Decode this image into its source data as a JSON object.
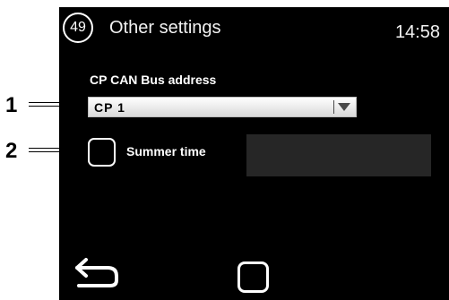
{
  "header": {
    "page_number": "49",
    "title": "Other settings",
    "time": "14:58"
  },
  "settings": {
    "can_bus_label": "CP CAN Bus address",
    "can_bus_value": "CP 1",
    "summer_time_label": "Summer time",
    "summer_time_checked": false
  },
  "navigation": {
    "back_icon": "back-arrow-icon",
    "home_icon": "home-square-icon"
  },
  "callouts": [
    "1",
    "2"
  ],
  "colors": {
    "screen_background": "#000000",
    "text": "#f2f2f2",
    "info_panel": "#262626",
    "dropdown_background": "#eaeaea"
  }
}
